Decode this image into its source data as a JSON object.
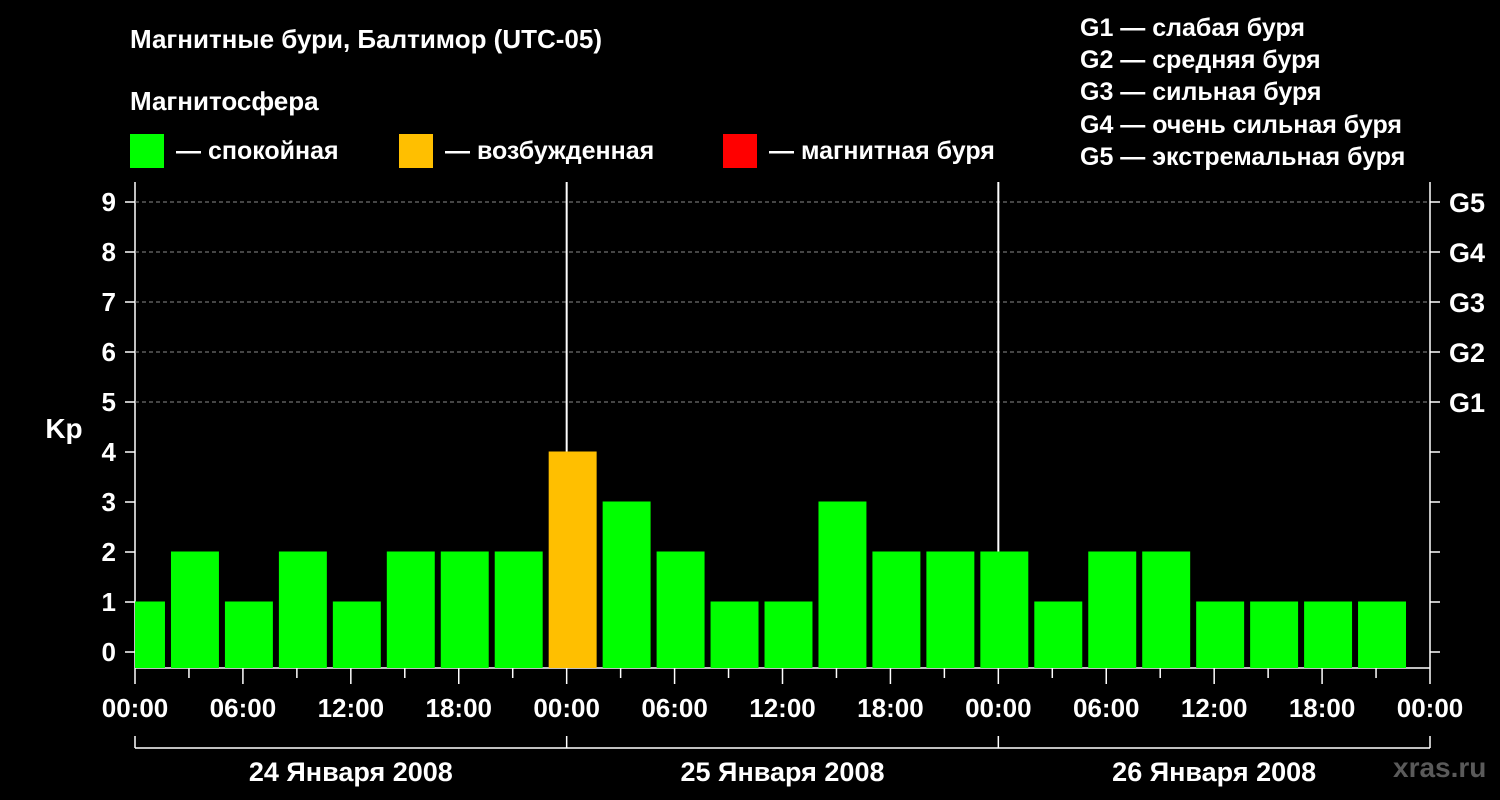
{
  "chart_data": {
    "type": "bar",
    "title": "Магнитные бури, Балтимор (UTC-05)",
    "ylabel": "Kp",
    "ylim": [
      0,
      9
    ],
    "yticks": [
      "0",
      "1",
      "2",
      "3",
      "4",
      "5",
      "6",
      "7",
      "8",
      "9"
    ],
    "storm_levels": [
      {
        "label": "G1",
        "kp": 5
      },
      {
        "label": "G2",
        "kp": 6
      },
      {
        "label": "G3",
        "kp": 7
      },
      {
        "label": "G4",
        "kp": 8
      },
      {
        "label": "G5",
        "kp": 9
      }
    ],
    "xticks": [
      "00:00",
      "06:00",
      "12:00",
      "18:00",
      "00:00",
      "06:00",
      "12:00",
      "18:00",
      "00:00",
      "06:00",
      "12:00",
      "18:00",
      "00:00"
    ],
    "days": [
      "24 Января 2008",
      "25 Января 2008",
      "26 Января 2008"
    ],
    "interval_hours": 3,
    "x_start": "24 Января 2008 00:00",
    "x_end": "27 Января 2008 00:00",
    "bars": [
      {
        "start": "24 Января 2008 00:00",
        "end": "24 Января 2008 02:00",
        "kp": 1,
        "state": "quiet"
      },
      {
        "start": "24 Января 2008 02:00",
        "end": "24 Января 2008 05:00",
        "kp": 2,
        "state": "quiet"
      },
      {
        "start": "24 Января 2008 05:00",
        "end": "24 Января 2008 08:00",
        "kp": 1,
        "state": "quiet"
      },
      {
        "start": "24 Января 2008 08:00",
        "end": "24 Января 2008 11:00",
        "kp": 2,
        "state": "quiet"
      },
      {
        "start": "24 Января 2008 11:00",
        "end": "24 Января 2008 14:00",
        "kp": 1,
        "state": "quiet"
      },
      {
        "start": "24 Января 2008 14:00",
        "end": "24 Января 2008 17:00",
        "kp": 2,
        "state": "quiet"
      },
      {
        "start": "24 Января 2008 17:00",
        "end": "24 Января 2008 20:00",
        "kp": 2,
        "state": "quiet"
      },
      {
        "start": "24 Января 2008 20:00",
        "end": "24 Января 2008 23:00",
        "kp": 2,
        "state": "quiet"
      },
      {
        "start": "24 Января 2008 23:00",
        "end": "25 Января 2008 02:00",
        "kp": 4,
        "state": "unsettled"
      },
      {
        "start": "25 Января 2008 02:00",
        "end": "25 Января 2008 05:00",
        "kp": 3,
        "state": "quiet"
      },
      {
        "start": "25 Января 2008 05:00",
        "end": "25 Января 2008 08:00",
        "kp": 2,
        "state": "quiet"
      },
      {
        "start": "25 Января 2008 08:00",
        "end": "25 Января 2008 11:00",
        "kp": 1,
        "state": "quiet"
      },
      {
        "start": "25 Января 2008 11:00",
        "end": "25 Января 2008 14:00",
        "kp": 1,
        "state": "quiet"
      },
      {
        "start": "25 Января 2008 14:00",
        "end": "25 Января 2008 17:00",
        "kp": 3,
        "state": "quiet"
      },
      {
        "start": "25 Января 2008 17:00",
        "end": "25 Января 2008 20:00",
        "kp": 2,
        "state": "quiet"
      },
      {
        "start": "25 Января 2008 20:00",
        "end": "25 Января 2008 23:00",
        "kp": 2,
        "state": "quiet"
      },
      {
        "start": "25 Января 2008 23:00",
        "end": "26 Января 2008 02:00",
        "kp": 2,
        "state": "quiet"
      },
      {
        "start": "26 Января 2008 02:00",
        "end": "26 Января 2008 05:00",
        "kp": 1,
        "state": "quiet"
      },
      {
        "start": "26 Января 2008 05:00",
        "end": "26 Января 2008 08:00",
        "kp": 2,
        "state": "quiet"
      },
      {
        "start": "26 Января 2008 08:00",
        "end": "26 Января 2008 11:00",
        "kp": 2,
        "state": "quiet"
      },
      {
        "start": "26 Января 2008 11:00",
        "end": "26 Января 2008 14:00",
        "kp": 1,
        "state": "quiet"
      },
      {
        "start": "26 Января 2008 14:00",
        "end": "26 Января 2008 17:00",
        "kp": 1,
        "state": "quiet"
      },
      {
        "start": "26 Января 2008 17:00",
        "end": "26 Января 2008 20:00",
        "kp": 1,
        "state": "quiet"
      },
      {
        "start": "26 Января 2008 20:00",
        "end": "26 Января 2008 23:00",
        "kp": 1,
        "state": "quiet"
      }
    ],
    "colors": {
      "quiet": "#00ff00",
      "unsettled": "#ffbf00",
      "storm": "#ff0000"
    },
    "grid": "dashed horizontal at Kp 5–9"
  },
  "legend": {
    "heading": "Магнитосфера",
    "items": [
      {
        "label": "— спокойная",
        "color": "#00ff00"
      },
      {
        "label": "— возбужденная",
        "color": "#ffbf00"
      },
      {
        "label": "— магнитная буря",
        "color": "#ff0000"
      }
    ]
  },
  "g_legend": [
    "G1 — слабая буря",
    "G2 — средняя буря",
    "G3 — сильная буря",
    "G4 — очень сильная буря",
    "G5 — экстремальная буря"
  ],
  "watermark": "xras.ru"
}
